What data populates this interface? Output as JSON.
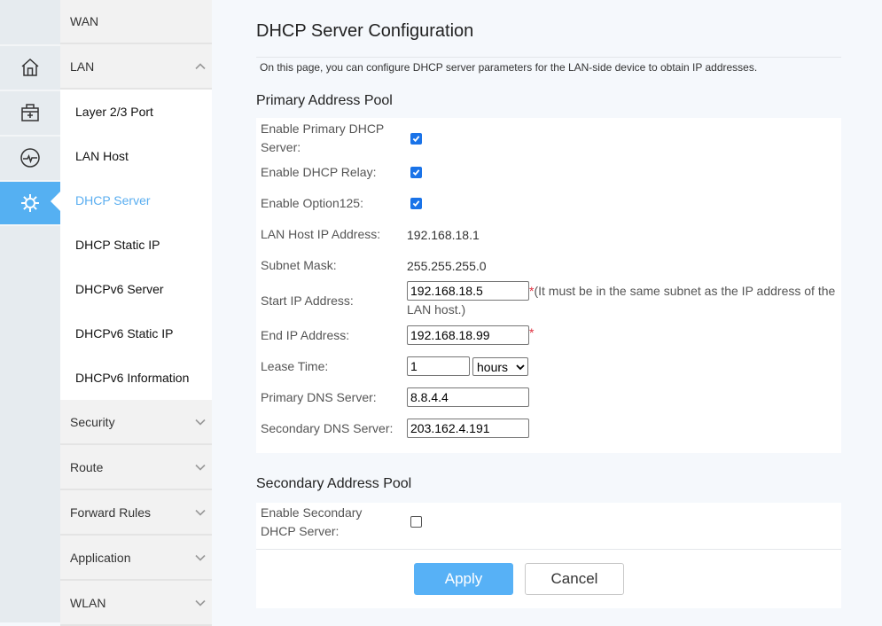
{
  "rail": {
    "items": [
      {
        "icon": "home-icon"
      },
      {
        "icon": "toolbox-icon"
      },
      {
        "icon": "activity-icon"
      },
      {
        "icon": "gear-icon",
        "active": true
      }
    ]
  },
  "submenu": {
    "groups": {
      "wan": "WAN",
      "lan": "LAN",
      "security": "Security",
      "route": "Route",
      "forward": "Forward Rules",
      "application": "Application",
      "wlan": "WLAN"
    },
    "lan_items": [
      "Layer 2/3 Port",
      "LAN Host",
      "DHCP Server",
      "DHCP Static IP",
      "DHCPv6 Server",
      "DHCPv6 Static IP",
      "DHCPv6 Information"
    ],
    "active_item": "DHCP Server"
  },
  "page": {
    "title": "DHCP Server Configuration",
    "description": "On this page, you can configure DHCP server parameters for the LAN-side device to obtain IP addresses.",
    "primary": {
      "title": "Primary Address Pool",
      "enable_primary_label": "Enable Primary DHCP Server:",
      "enable_primary": true,
      "enable_relay_label": "Enable DHCP Relay:",
      "enable_relay": true,
      "enable_option125_label": "Enable Option125:",
      "enable_option125": true,
      "lan_host_ip_label": "LAN Host IP Address:",
      "lan_host_ip": "192.168.18.1",
      "subnet_label": "Subnet Mask:",
      "subnet": "255.255.255.0",
      "start_ip_label": "Start IP Address:",
      "start_ip": "192.168.18.5",
      "required_mark": "*",
      "start_ip_note": "(It must be in the same subnet as the IP address of the LAN host.)",
      "end_ip_label": "End IP Address:",
      "end_ip": "192.168.18.99",
      "lease_label": "Lease Time:",
      "lease_value": "1",
      "lease_unit": "hours",
      "dns1_label": "Primary DNS Server:",
      "dns1": "8.8.4.4",
      "dns2_label": "Secondary DNS Server:",
      "dns2": "203.162.4.191"
    },
    "secondary": {
      "title": "Secondary Address Pool",
      "enable_label": "Enable Secondary DHCP Server:",
      "enable": false
    },
    "apply_label": "Apply",
    "cancel_label": "Cancel"
  },
  "colors": {
    "accent": "#55b0f2",
    "active_text": "#5aaef0",
    "checkbox": "#1a73e8"
  }
}
